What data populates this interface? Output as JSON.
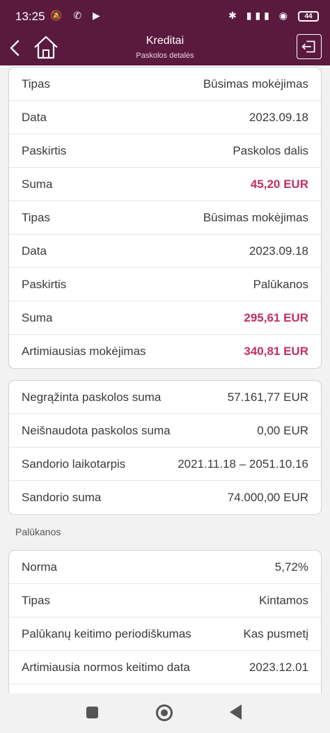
{
  "status": {
    "time": "13:25",
    "left_icons": "🔕 ✆ ▶",
    "right_icons": "✱ ▮▮▮ ◉",
    "battery": "44"
  },
  "header": {
    "title": "Kreditai",
    "subtitle": "Paskolos detalės"
  },
  "colors": {
    "brand": "#5a1a3e",
    "accent": "#c2305e"
  },
  "payments": [
    {
      "label": "Tipas",
      "value": "Būsimas mokėjimas",
      "accent": false
    },
    {
      "label": "Data",
      "value": "2023.09.18",
      "accent": false
    },
    {
      "label": "Paskirtis",
      "value": "Paskolos dalis",
      "accent": false
    },
    {
      "label": "Suma",
      "value": "45,20 EUR",
      "accent": true
    },
    {
      "label": "Tipas",
      "value": "Būsimas mokėjimas",
      "accent": false
    },
    {
      "label": "Data",
      "value": "2023.09.18",
      "accent": false
    },
    {
      "label": "Paskirtis",
      "value": "Palūkanos",
      "accent": false
    },
    {
      "label": "Suma",
      "value": "295,61 EUR",
      "accent": true
    },
    {
      "label": "Artimiausias mokėjimas",
      "value": "340,81 EUR",
      "accent": true
    }
  ],
  "loan": [
    {
      "label": "Negrąžinta paskolos suma",
      "value": "57.161,77 EUR"
    },
    {
      "label": "Neišnaudota paskolos suma",
      "value": "0,00 EUR"
    },
    {
      "label": "Sandorio laikotarpis",
      "value": "2021.11.18 – 2051.10.16"
    },
    {
      "label": "Sandorio suma",
      "value": "74.000,00 EUR"
    }
  ],
  "interest_section": {
    "title": "Palūkanos",
    "rows": [
      {
        "label": "Norma",
        "value": "5,72%"
      },
      {
        "label": "Tipas",
        "value": "Kintamos"
      },
      {
        "label": "Palūkanų keitimo periodiškumas",
        "value": "Kas pusmetį"
      },
      {
        "label": "Artimiausia normos keitimo data",
        "value": "2023.12.01"
      }
    ]
  }
}
